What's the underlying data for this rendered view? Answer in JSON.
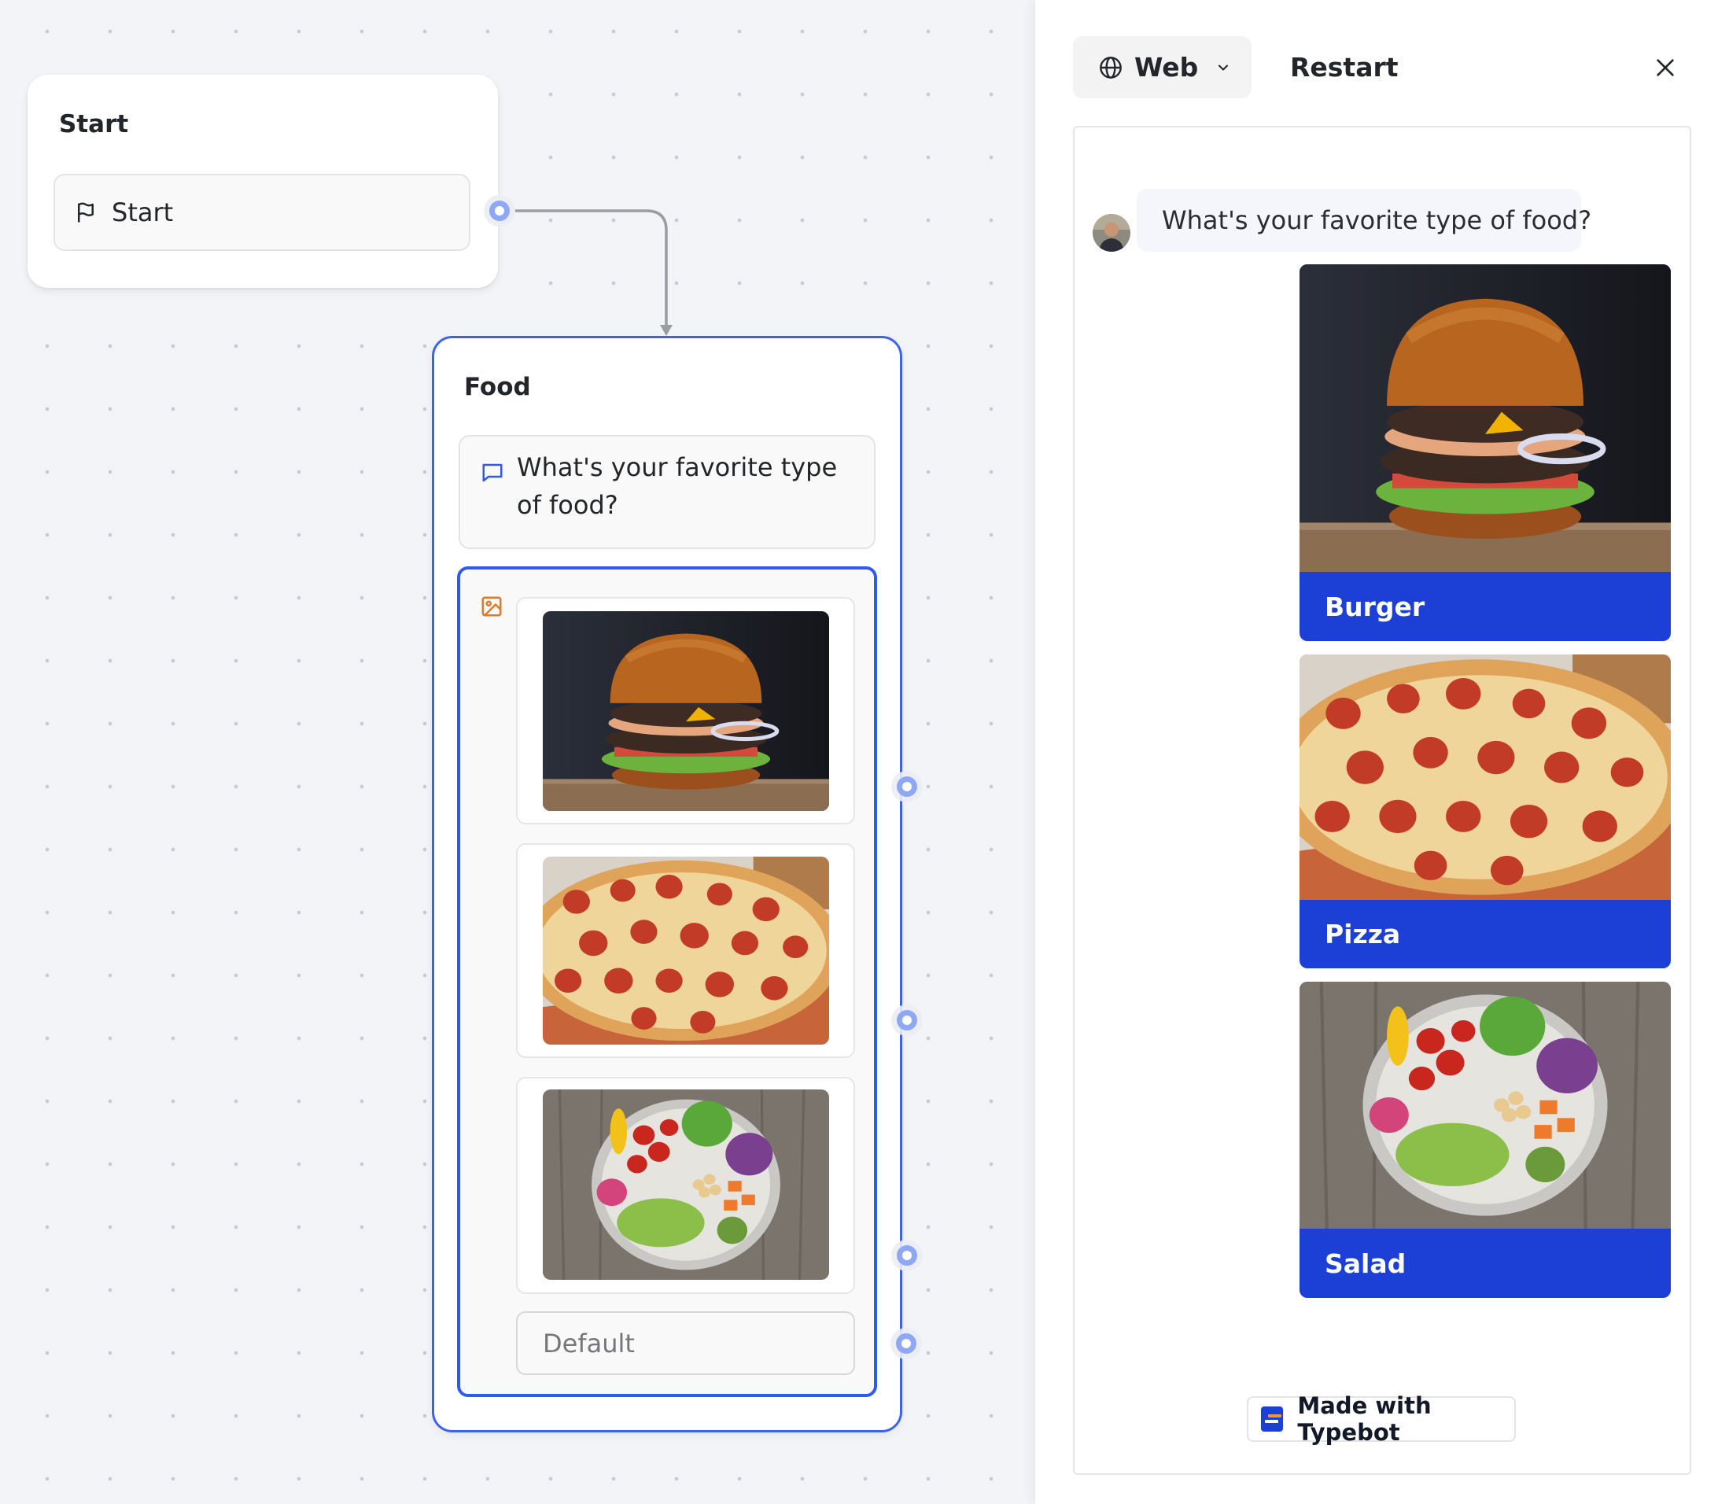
{
  "canvas": {
    "start_node": {
      "title": "Start",
      "block_label": "Start"
    },
    "food_node": {
      "title": "Food",
      "text_block": "What's your favorite type of food?",
      "picture_choice_items": [
        {
          "image": "burger"
        },
        {
          "image": "pizza"
        },
        {
          "image": "salad"
        }
      ],
      "default_label": "Default"
    }
  },
  "preview": {
    "platform_label": "Web",
    "restart_label": "Restart",
    "chat": {
      "bot_message": "What's your favorite type of food?",
      "choices": [
        {
          "label": "Burger",
          "image": "burger"
        },
        {
          "label": "Pizza",
          "image": "pizza"
        },
        {
          "label": "Salad",
          "image": "salad"
        }
      ],
      "branding_label": "Made with Typebot"
    }
  },
  "colors": {
    "accent": "#1c40d6",
    "node_border": "#3b63f0",
    "handle": "#8fa8f6",
    "picture_icon": "#e07a2e"
  }
}
